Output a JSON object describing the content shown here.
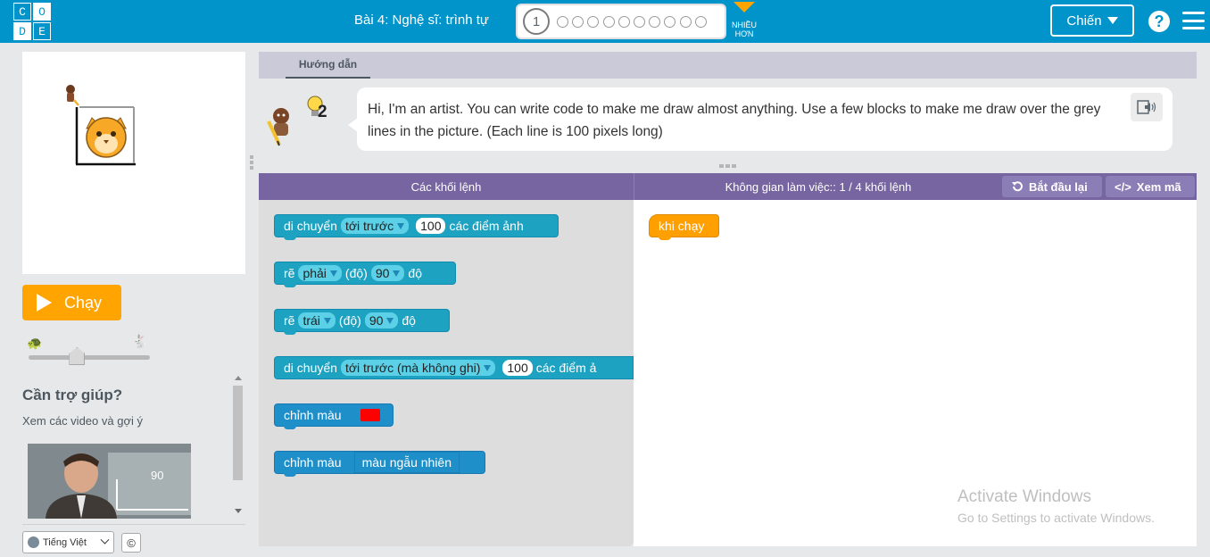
{
  "header": {
    "logo_letters": [
      "C",
      "O",
      "D",
      "E"
    ],
    "level_title": "Bài 4: Nghệ sĩ: trình tự",
    "progress": {
      "current_puzzle": "1",
      "total_puzzles": 11
    },
    "more_label": "NHIỀU HƠN",
    "user_label": "Chiến",
    "help_icon": "question-circle-icon",
    "menu_icon": "hamburger-icon"
  },
  "run_button": {
    "label": "Chạy"
  },
  "speed_slider": {
    "value": 0.4,
    "slow_icon": "turtle-icon",
    "fast_icon": "rabbit-icon"
  },
  "help": {
    "title": "Cần trợ giúp?",
    "subtitle": "Xem các video và gợi ý",
    "video_overlay": "90"
  },
  "footer": {
    "language": "Tiếng Việt",
    "copyright": "©"
  },
  "instructions": {
    "tab_label": "Hướng dẫn",
    "hint_count": "2",
    "text": "Hi, I'm an artist. You can write code to make me draw almost anything. Use a few blocks to make me draw over the grey lines in the picture. (Each line is 100 pixels long)"
  },
  "workspace_header": {
    "toolbox_title": "Các khối lệnh",
    "workspace_title": "Không gian làm việc:: 1 / 4 khối lệnh",
    "restart_label": "Bắt đầu lại",
    "show_code_label": "Xem mã"
  },
  "toolbox": {
    "move_forward": {
      "label": "di chuyển",
      "direction": "tới trước",
      "value": "100",
      "unit": "các điểm ảnh"
    },
    "turn_right": {
      "label": "rẽ",
      "direction": "phải",
      "paren": "(độ)",
      "value": "90",
      "unit": "độ"
    },
    "turn_left": {
      "label": "rẽ",
      "direction": "trái",
      "paren": "(độ)",
      "value": "90",
      "unit": "độ"
    },
    "jump_forward": {
      "label": "di chuyển",
      "direction": "tới trước (mà không ghi)",
      "value": "100",
      "unit": "các điểm ả"
    },
    "set_color": {
      "label": "chỉnh màu",
      "color": "#ff0000"
    },
    "set_random_color": {
      "label": "chỉnh màu",
      "value": "màu ngẫu nhiên"
    }
  },
  "workspace": {
    "when_run_label": "khi chạy"
  },
  "watermark": {
    "title": "Activate Windows",
    "subtitle": "Go to Settings to activate Windows."
  },
  "colors": {
    "header_bg": "#0094ca",
    "accent_orange": "#ffa400",
    "workspace_header": "#7665a0"
  }
}
